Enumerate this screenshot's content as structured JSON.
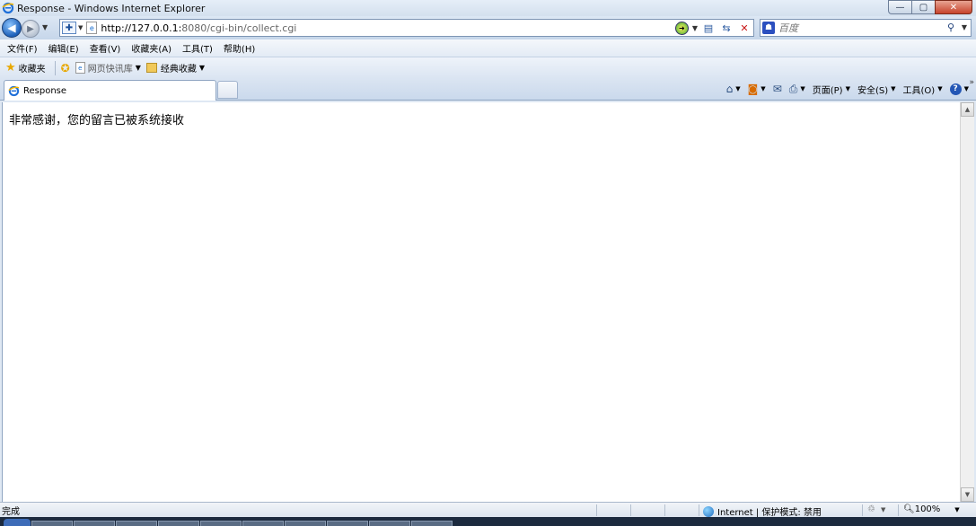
{
  "window": {
    "title": "Response - Windows Internet Explorer",
    "minimize": "—",
    "maximize": "▢",
    "close": "✕"
  },
  "nav": {
    "url_host": "http://127.0.0.1:",
    "url_rest": "8080/cgi-bin/collect.cgi",
    "search_placeholder": "百度"
  },
  "menu": [
    "文件(F)",
    "编辑(E)",
    "查看(V)",
    "收藏夹(A)",
    "工具(T)",
    "帮助(H)"
  ],
  "favorites": {
    "label": "收藏夹",
    "item1": "网页快讯库",
    "item2": "经典收藏"
  },
  "tab": {
    "label": "Response"
  },
  "commands": {
    "page": "页面(P)",
    "safety": "安全(S)",
    "tools": "工具(O)"
  },
  "content": {
    "message": "非常感谢，您的留言已被系统接收"
  },
  "status": {
    "text": "完成",
    "zone": "Internet | 保护模式: 禁用",
    "zoom": "100%"
  },
  "colors": {
    "chrome": "#dfe8f3",
    "accent": "#1c5fb8"
  }
}
